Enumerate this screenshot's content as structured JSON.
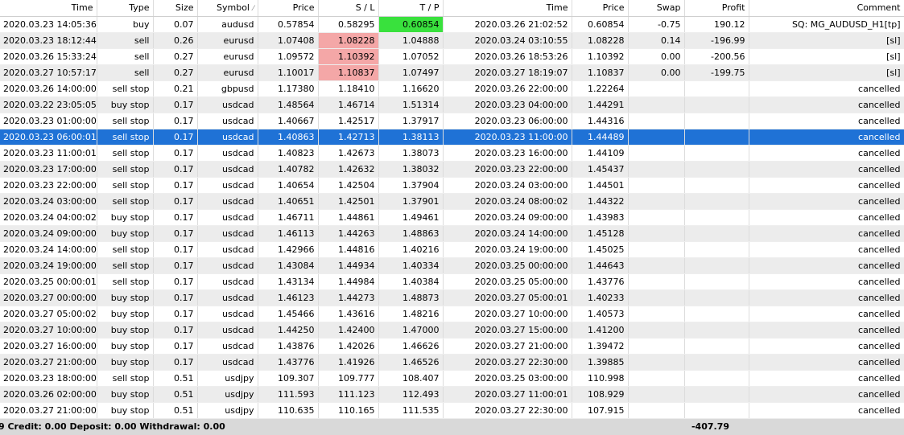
{
  "columns": [
    "Time",
    "Type",
    "Size",
    "Symbol",
    "Price",
    "S / L",
    "T / P",
    "Time",
    "Price",
    "Swap",
    "Profit",
    "Comment"
  ],
  "sort_icon": "sort-arrow-icon",
  "colors": {
    "selected": "#1f72d6",
    "sl_hit": "#f4a7a7",
    "tp_hit": "#39e13d",
    "footer": "#d9d9d9"
  },
  "rows": [
    {
      "open_time": "2020.03.23 14:05:36",
      "type": "buy",
      "size": "0.07",
      "symbol": "audusd",
      "price": "0.57854",
      "sl": "0.58295",
      "tp": "0.60854",
      "close_time": "2020.03.26 21:02:52",
      "close_price": "0.60854",
      "swap": "-0.75",
      "profit": "190.12",
      "comment": "SQ: MG_AUDUSD_H1[tp]",
      "hl": "tp"
    },
    {
      "open_time": "2020.03.23 18:12:44",
      "type": "sell",
      "size": "0.26",
      "symbol": "eurusd",
      "price": "1.07408",
      "sl": "1.08228",
      "tp": "1.04888",
      "close_time": "2020.03.24 03:10:55",
      "close_price": "1.08228",
      "swap": "0.14",
      "profit": "-196.99",
      "comment": "[sl]",
      "hl": "sl"
    },
    {
      "open_time": "2020.03.26 15:33:24",
      "type": "sell",
      "size": "0.27",
      "symbol": "eurusd",
      "price": "1.09572",
      "sl": "1.10392",
      "tp": "1.07052",
      "close_time": "2020.03.26 18:53:26",
      "close_price": "1.10392",
      "swap": "0.00",
      "profit": "-200.56",
      "comment": "[sl]",
      "hl": "sl"
    },
    {
      "open_time": "2020.03.27 10:57:17",
      "type": "sell",
      "size": "0.27",
      "symbol": "eurusd",
      "price": "1.10017",
      "sl": "1.10837",
      "tp": "1.07497",
      "close_time": "2020.03.27 18:19:07",
      "close_price": "1.10837",
      "swap": "0.00",
      "profit": "-199.75",
      "comment": "[sl]",
      "hl": "sl"
    },
    {
      "open_time": "2020.03.26 14:00:00",
      "type": "sell stop",
      "size": "0.21",
      "symbol": "gbpusd",
      "price": "1.17380",
      "sl": "1.18410",
      "tp": "1.16620",
      "close_time": "2020.03.26 22:00:00",
      "close_price": "1.22264",
      "swap": "",
      "profit": "",
      "comment": "cancelled",
      "hl": ""
    },
    {
      "open_time": "2020.03.22 23:05:05",
      "type": "buy stop",
      "size": "0.17",
      "symbol": "usdcad",
      "price": "1.48564",
      "sl": "1.46714",
      "tp": "1.51314",
      "close_time": "2020.03.23 04:00:00",
      "close_price": "1.44291",
      "swap": "",
      "profit": "",
      "comment": "cancelled",
      "hl": ""
    },
    {
      "open_time": "2020.03.23 01:00:00",
      "type": "sell stop",
      "size": "0.17",
      "symbol": "usdcad",
      "price": "1.40667",
      "sl": "1.42517",
      "tp": "1.37917",
      "close_time": "2020.03.23 06:00:00",
      "close_price": "1.44316",
      "swap": "",
      "profit": "",
      "comment": "cancelled",
      "hl": ""
    },
    {
      "open_time": "2020.03.23 06:00:01",
      "type": "sell stop",
      "size": "0.17",
      "symbol": "usdcad",
      "price": "1.40863",
      "sl": "1.42713",
      "tp": "1.38113",
      "close_time": "2020.03.23 11:00:00",
      "close_price": "1.44489",
      "swap": "",
      "profit": "",
      "comment": "cancelled",
      "hl": "",
      "selected": true
    },
    {
      "open_time": "2020.03.23 11:00:01",
      "type": "sell stop",
      "size": "0.17",
      "symbol": "usdcad",
      "price": "1.40823",
      "sl": "1.42673",
      "tp": "1.38073",
      "close_time": "2020.03.23 16:00:00",
      "close_price": "1.44109",
      "swap": "",
      "profit": "",
      "comment": "cancelled",
      "hl": ""
    },
    {
      "open_time": "2020.03.23 17:00:00",
      "type": "sell stop",
      "size": "0.17",
      "symbol": "usdcad",
      "price": "1.40782",
      "sl": "1.42632",
      "tp": "1.38032",
      "close_time": "2020.03.23 22:00:00",
      "close_price": "1.45437",
      "swap": "",
      "profit": "",
      "comment": "cancelled",
      "hl": ""
    },
    {
      "open_time": "2020.03.23 22:00:00",
      "type": "sell stop",
      "size": "0.17",
      "symbol": "usdcad",
      "price": "1.40654",
      "sl": "1.42504",
      "tp": "1.37904",
      "close_time": "2020.03.24 03:00:00",
      "close_price": "1.44501",
      "swap": "",
      "profit": "",
      "comment": "cancelled",
      "hl": ""
    },
    {
      "open_time": "2020.03.24 03:00:00",
      "type": "sell stop",
      "size": "0.17",
      "symbol": "usdcad",
      "price": "1.40651",
      "sl": "1.42501",
      "tp": "1.37901",
      "close_time": "2020.03.24 08:00:02",
      "close_price": "1.44322",
      "swap": "",
      "profit": "",
      "comment": "cancelled",
      "hl": ""
    },
    {
      "open_time": "2020.03.24 04:00:02",
      "type": "buy stop",
      "size": "0.17",
      "symbol": "usdcad",
      "price": "1.46711",
      "sl": "1.44861",
      "tp": "1.49461",
      "close_time": "2020.03.24 09:00:00",
      "close_price": "1.43983",
      "swap": "",
      "profit": "",
      "comment": "cancelled",
      "hl": ""
    },
    {
      "open_time": "2020.03.24 09:00:00",
      "type": "buy stop",
      "size": "0.17",
      "symbol": "usdcad",
      "price": "1.46113",
      "sl": "1.44263",
      "tp": "1.48863",
      "close_time": "2020.03.24 14:00:00",
      "close_price": "1.45128",
      "swap": "",
      "profit": "",
      "comment": "cancelled",
      "hl": ""
    },
    {
      "open_time": "2020.03.24 14:00:00",
      "type": "sell stop",
      "size": "0.17",
      "symbol": "usdcad",
      "price": "1.42966",
      "sl": "1.44816",
      "tp": "1.40216",
      "close_time": "2020.03.24 19:00:00",
      "close_price": "1.45025",
      "swap": "",
      "profit": "",
      "comment": "cancelled",
      "hl": ""
    },
    {
      "open_time": "2020.03.24 19:00:00",
      "type": "sell stop",
      "size": "0.17",
      "symbol": "usdcad",
      "price": "1.43084",
      "sl": "1.44934",
      "tp": "1.40334",
      "close_time": "2020.03.25 00:00:00",
      "close_price": "1.44643",
      "swap": "",
      "profit": "",
      "comment": "cancelled",
      "hl": ""
    },
    {
      "open_time": "2020.03.25 00:00:01",
      "type": "sell stop",
      "size": "0.17",
      "symbol": "usdcad",
      "price": "1.43134",
      "sl": "1.44984",
      "tp": "1.40384",
      "close_time": "2020.03.25 05:00:00",
      "close_price": "1.43776",
      "swap": "",
      "profit": "",
      "comment": "cancelled",
      "hl": ""
    },
    {
      "open_time": "2020.03.27 00:00:00",
      "type": "buy stop",
      "size": "0.17",
      "symbol": "usdcad",
      "price": "1.46123",
      "sl": "1.44273",
      "tp": "1.48873",
      "close_time": "2020.03.27 05:00:01",
      "close_price": "1.40233",
      "swap": "",
      "profit": "",
      "comment": "cancelled",
      "hl": ""
    },
    {
      "open_time": "2020.03.27 05:00:02",
      "type": "buy stop",
      "size": "0.17",
      "symbol": "usdcad",
      "price": "1.45466",
      "sl": "1.43616",
      "tp": "1.48216",
      "close_time": "2020.03.27 10:00:00",
      "close_price": "1.40573",
      "swap": "",
      "profit": "",
      "comment": "cancelled",
      "hl": ""
    },
    {
      "open_time": "2020.03.27 10:00:00",
      "type": "buy stop",
      "size": "0.17",
      "symbol": "usdcad",
      "price": "1.44250",
      "sl": "1.42400",
      "tp": "1.47000",
      "close_time": "2020.03.27 15:00:00",
      "close_price": "1.41200",
      "swap": "",
      "profit": "",
      "comment": "cancelled",
      "hl": ""
    },
    {
      "open_time": "2020.03.27 16:00:00",
      "type": "buy stop",
      "size": "0.17",
      "symbol": "usdcad",
      "price": "1.43876",
      "sl": "1.42026",
      "tp": "1.46626",
      "close_time": "2020.03.27 21:00:00",
      "close_price": "1.39472",
      "swap": "",
      "profit": "",
      "comment": "cancelled",
      "hl": ""
    },
    {
      "open_time": "2020.03.27 21:00:00",
      "type": "buy stop",
      "size": "0.17",
      "symbol": "usdcad",
      "price": "1.43776",
      "sl": "1.41926",
      "tp": "1.46526",
      "close_time": "2020.03.27 22:30:00",
      "close_price": "1.39885",
      "swap": "",
      "profit": "",
      "comment": "cancelled",
      "hl": ""
    },
    {
      "open_time": "2020.03.23 18:00:00",
      "type": "sell stop",
      "size": "0.51",
      "symbol": "usdjpy",
      "price": "109.307",
      "sl": "109.777",
      "tp": "108.407",
      "close_time": "2020.03.25 03:00:00",
      "close_price": "110.998",
      "swap": "",
      "profit": "",
      "comment": "cancelled",
      "hl": ""
    },
    {
      "open_time": "2020.03.26 02:00:00",
      "type": "buy stop",
      "size": "0.51",
      "symbol": "usdjpy",
      "price": "111.593",
      "sl": "111.123",
      "tp": "112.493",
      "close_time": "2020.03.27 11:00:01",
      "close_price": "108.929",
      "swap": "",
      "profit": "",
      "comment": "cancelled",
      "hl": ""
    },
    {
      "open_time": "2020.03.27 21:00:00",
      "type": "buy stop",
      "size": "0.51",
      "symbol": "usdjpy",
      "price": "110.635",
      "sl": "110.165",
      "tp": "111.535",
      "close_time": "2020.03.27 22:30:00",
      "close_price": "107.915",
      "swap": "",
      "profit": "",
      "comment": "cancelled",
      "hl": ""
    }
  ],
  "footer": {
    "summary": "9  Credit: 0.00  Deposit: 0.00  Withdrawal: 0.00",
    "total_profit": "-407.79"
  }
}
